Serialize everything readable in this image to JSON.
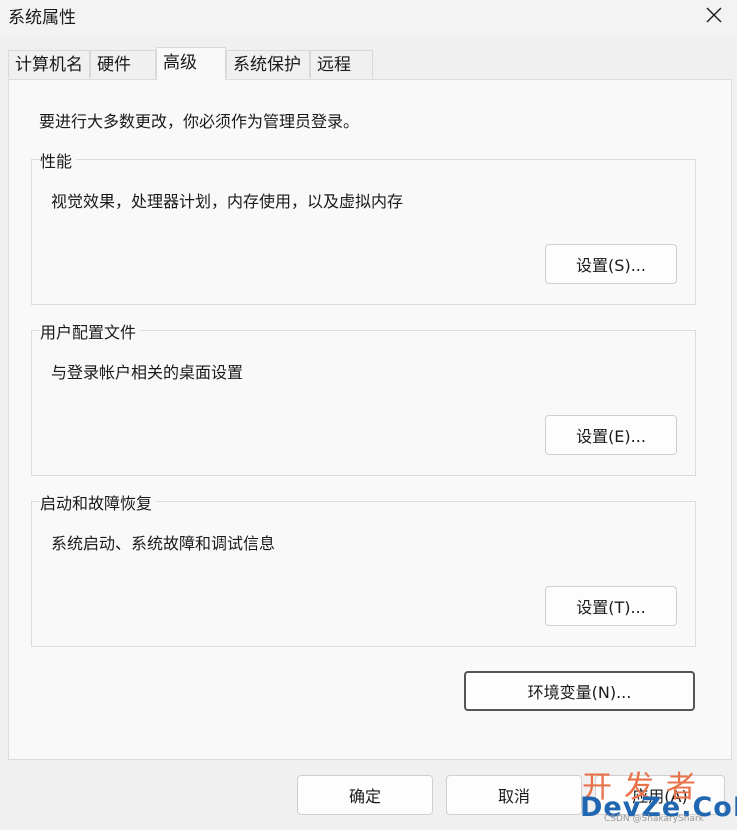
{
  "window": {
    "title": "系统属性"
  },
  "tabs": [
    {
      "label": "计算机名"
    },
    {
      "label": "硬件"
    },
    {
      "label": "高级"
    },
    {
      "label": "系统保护"
    },
    {
      "label": "远程"
    }
  ],
  "panel": {
    "intro": "要进行大多数更改，你必须作为管理员登录。",
    "performance": {
      "title": "性能",
      "desc": "视觉效果，处理器计划，内存使用，以及虚拟内存",
      "button": "设置(S)..."
    },
    "user_profiles": {
      "title": "用户配置文件",
      "desc": "与登录帐户相关的桌面设置",
      "button": "设置(E)..."
    },
    "startup_recovery": {
      "title": "启动和故障恢复",
      "desc": "系统启动、系统故障和调试信息",
      "button": "设置(T)..."
    },
    "env_button": "环境变量(N)..."
  },
  "footer": {
    "ok": "确定",
    "cancel": "取消",
    "apply": "应用(A)"
  },
  "watermark": {
    "cn": "开发者",
    "en": "DevZe.CoM",
    "small": "CSDN @ShakaryShark"
  },
  "icons": {
    "close": "close-icon"
  }
}
